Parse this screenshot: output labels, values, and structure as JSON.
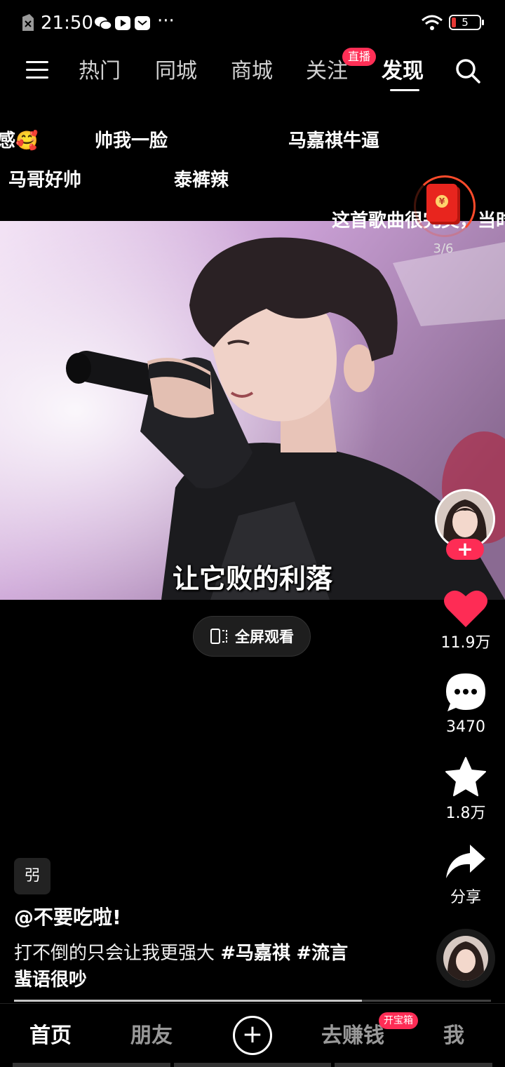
{
  "status_bar": {
    "time": "21:50",
    "battery": "5"
  },
  "top_nav": {
    "menu_icon": "menu-icon",
    "tabs": [
      {
        "label": "热门",
        "active": false
      },
      {
        "label": "同城",
        "active": false
      },
      {
        "label": "商城",
        "active": false
      },
      {
        "label": "关注",
        "active": false
      },
      {
        "label": "发现",
        "active": true
      }
    ],
    "live_badge": "直播",
    "search_icon": "search-icon"
  },
  "danmaku": [
    "感🥰",
    "帅我一脸",
    "马嘉祺牛逼",
    "马哥好帅",
    "泰裤辣",
    "这首歌曲很完美，当时"
  ],
  "red_packet": {
    "progress": "3/6",
    "coin": "¥"
  },
  "video": {
    "subtitle": "让它败的利落"
  },
  "fullscreen_button": {
    "label": "全屏观看"
  },
  "right_rail": {
    "likes": "11.9万",
    "comments": "3470",
    "favorites": "1.8万",
    "share": "分享"
  },
  "caption": {
    "badge": "弜",
    "author": "@不要吃啦!",
    "text": "打不倒的只会让我更强大 ",
    "hashtags": [
      "#马嘉祺",
      "#流言"
    ],
    "line2": "蜚语很吵"
  },
  "playback_progress": 0.73,
  "bottom_nav": {
    "items": [
      "首页",
      "朋友",
      "去赚钱",
      "我"
    ],
    "active": "首页",
    "chest_badge": "开宝箱"
  },
  "colors": {
    "accent": "#fe2c55",
    "like": "#fe2c55",
    "background": "#000000"
  }
}
